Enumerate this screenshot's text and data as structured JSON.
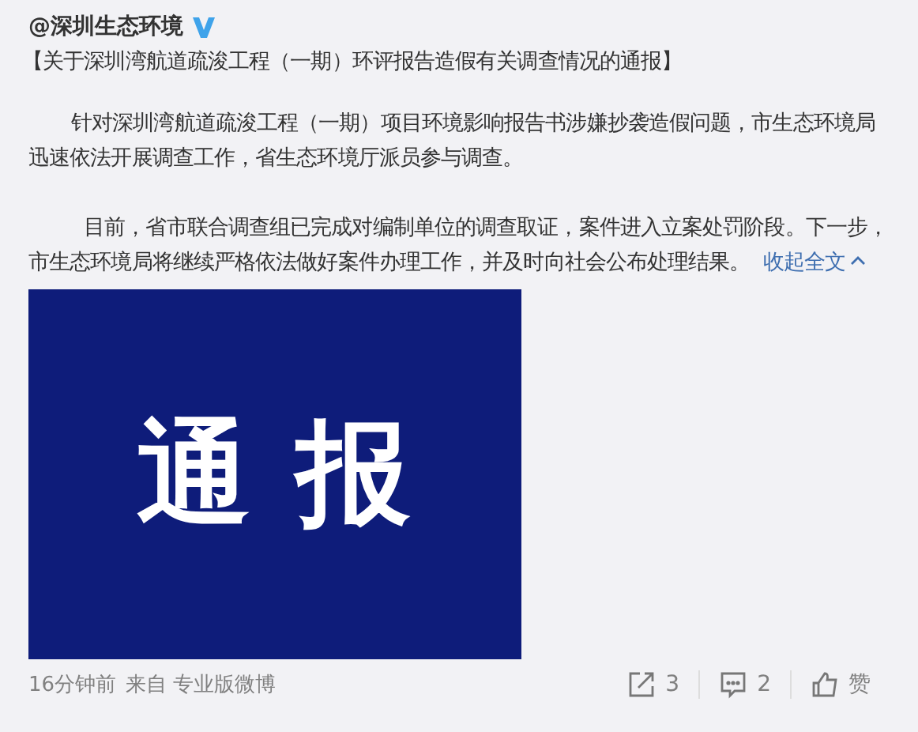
{
  "post": {
    "author": "@深圳生态环境",
    "verified": true,
    "title": "【关于深圳湾航道疏浚工程（一期）环评报告造假有关调查情况的通报】",
    "paragraphs": [
      "针对深圳湾航道疏浚工程（一期）项目环境影响报告书涉嫌抄袭造假问题，市生态环境局迅速依法开展调查工作，省生态环境厅派员参与调查。",
      "目前，省市联合调查组已完成对编制单位的调查取证，案件进入立案处罚阶段。下一步，市生态环境局将继续严格依法做好案件办理工作，并及时向社会公布处理结果。"
    ],
    "collapse_link": "收起全文",
    "image": {
      "text": "通 报"
    },
    "time": "16分钟前",
    "source": "来自 专业版微博",
    "actions": [
      {
        "kind": "share",
        "label": "3"
      },
      {
        "kind": "comment",
        "label": "2"
      },
      {
        "kind": "like",
        "label": "赞"
      }
    ]
  }
}
